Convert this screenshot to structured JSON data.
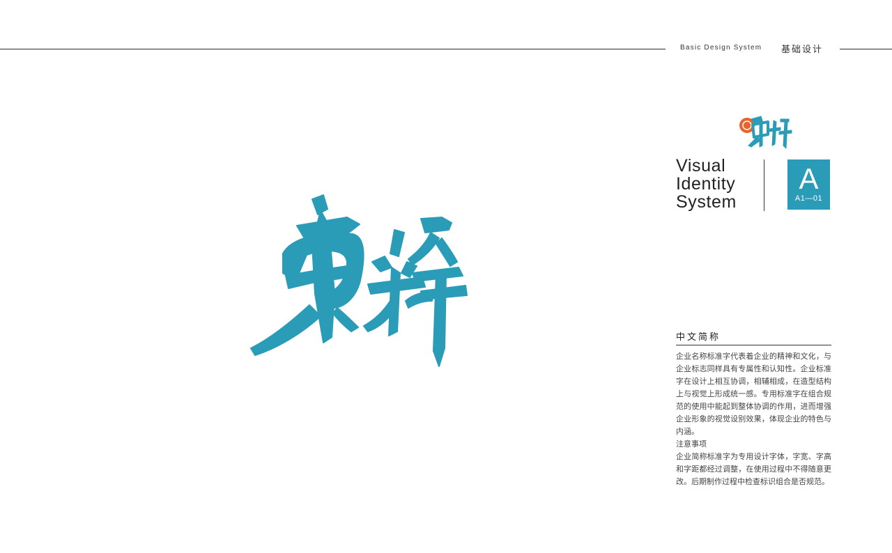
{
  "header": {
    "subtitle_en": "Basic Design System",
    "subtitle_cn": "基础设计"
  },
  "brand": {
    "name": "東粹",
    "color": "#2a9cb8",
    "accent": "#e8642c"
  },
  "vi": {
    "title_lines": [
      "Visual",
      "Identity",
      "System"
    ],
    "section_letter": "A",
    "page_code": "A1—01"
  },
  "section": {
    "title": "中文简称",
    "paragraph1": "企业名称标准字代表着企业的精神和文化，与企业标志同样具有专属性和认知性。企业标准字在设计上相互协调，相辅相成，在造型结构上与视觉上形成统一感。专用标准字在组合规范的使用中能起到整体协调的作用，进而增强企业形象的视觉设别效果，体现企业的特色与内涵。",
    "notes_title": "注意事项",
    "paragraph2": "企业简称标准字为专用设计字体，字宽、字高和字距都经过调整，在使用过程中不得随意更改。后期制作过程中检查标识组合是否规范。"
  }
}
